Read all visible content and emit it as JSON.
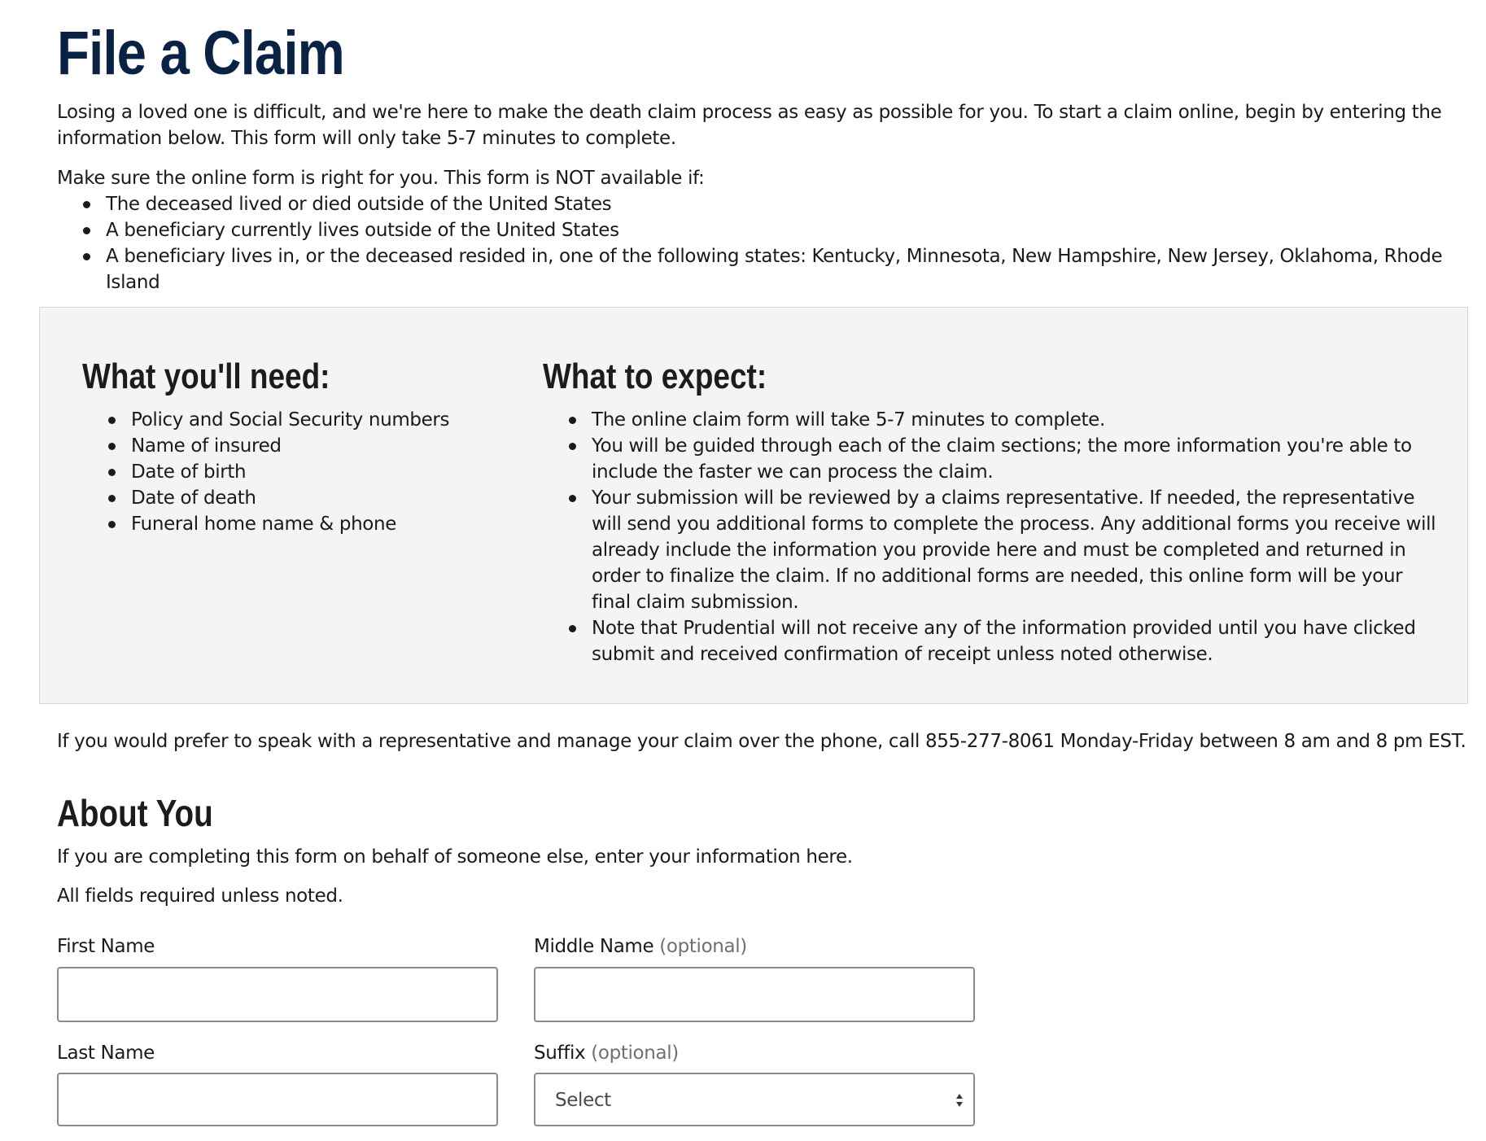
{
  "page": {
    "title": "File a Claim",
    "intro": "Losing a loved one is difficult, and we're here to make the death claim process as easy as possible for you. To start a claim online, begin by entering the information below. This form will only take 5-7 minutes to complete.",
    "availability_lead": "Make sure the online form is right for you. This form is NOT available if:",
    "availability_items": [
      "The deceased lived or died outside of the United States",
      "A beneficiary currently lives outside of the United States",
      "A beneficiary lives in, or the deceased resided in, one of the following states: Kentucky, Minnesota, New Hampshire, New Jersey, Oklahoma, Rhode Island"
    ]
  },
  "info_box": {
    "need_heading": "What you'll need:",
    "need_items": [
      "Policy and Social Security numbers",
      "Name of insured",
      "Date of birth",
      "Date of death",
      "Funeral home name & phone"
    ],
    "expect_heading": "What to expect:",
    "expect_items": [
      "The online claim form will take 5-7 minutes to complete.",
      "You will be guided through each of the claim sections; the more information you're able to include the faster we can process the claim.",
      "Your submission will be reviewed by a claims representative. If needed, the representative will send you additional forms to complete the process. Any additional forms you receive will already include the information you provide here and must be completed and returned in order to finalize the claim. If no additional forms are needed, this online form will be your final claim submission.",
      "Note that Prudential will not receive any of the information provided until you have clicked submit and received confirmation of receipt unless noted otherwise."
    ]
  },
  "phone_note": "If you would prefer to speak with a representative and manage your claim over the phone, call 855-277-8061 Monday-Friday between 8 am and 8 pm EST.",
  "about": {
    "heading": "About You",
    "description": "If you are completing this form on behalf of someone else, enter your information here.",
    "required_note": "All fields required unless noted.",
    "fields": {
      "first_name": {
        "label": "First Name",
        "value": ""
      },
      "middle_name": {
        "label": "Middle Name",
        "optional": "(optional)",
        "value": ""
      },
      "last_name": {
        "label": "Last Name",
        "value": ""
      },
      "suffix": {
        "label": "Suffix",
        "optional": "(optional)",
        "selected": "Select"
      }
    }
  },
  "colors": {
    "title": "#0a2244",
    "box_background": "#f4f4f4",
    "input_border": "#8a8a8a",
    "optional_text": "#707070"
  }
}
